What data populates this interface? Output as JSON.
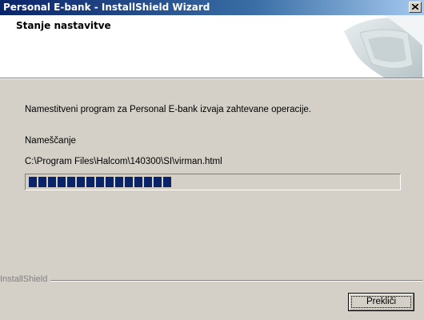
{
  "window": {
    "title": "Personal E-bank - InstallShield Wizard",
    "close_glyph": "✕"
  },
  "header": {
    "title": "Stanje nastavitve",
    "graphic_icon": "computer-wizard-graphic"
  },
  "main": {
    "description": "Namestitveni program za Personal E-bank izvaja zahtevane operacije.",
    "status_label": "Nameščanje",
    "current_file": "C:\\Program Files\\Halcom\\140300\\SI\\virman.html",
    "progress": 0.41
  },
  "footer": {
    "brand": "InstallShield",
    "cancel_label": "Prekliči"
  },
  "colors": {
    "titlebar_start": "#0a246a",
    "titlebar_end": "#a6caf0",
    "progress_block": "#0a246a",
    "face": "#d4d0c8"
  }
}
